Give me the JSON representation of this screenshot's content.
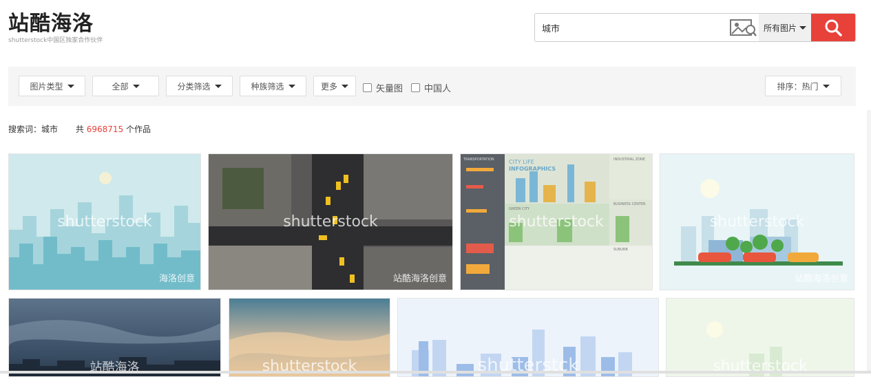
{
  "logo": {
    "title": "站酷海洛",
    "subtitle": "shutterstock中国区独家合作伙伴"
  },
  "search": {
    "query": "城市",
    "scope": "所有图片",
    "image_search_icon": "image-search-icon",
    "search_icon": "magnifier-icon"
  },
  "filters": {
    "buttons": [
      "图片类型",
      "全部",
      "分类筛选",
      "种族筛选",
      "更多"
    ],
    "checkboxes": [
      "矢量图",
      "中国人"
    ],
    "sort": "排序：热门"
  },
  "summary": {
    "keyword_label": "搜索词：城市",
    "prefix": "共",
    "count": "6968715",
    "suffix": "个作品"
  },
  "results": [
    {
      "watermark": "shutterstock",
      "corner_text": "海洛创意"
    },
    {
      "watermark": "shutterstock",
      "corner_text": "站酷海洛创意"
    },
    {
      "watermark": "shutterstock",
      "corner_text": "",
      "labels": [
        "CITY LIFE",
        "INFOGRAPHICS",
        "TRANSPORTATION",
        "INDUSTRIAL ZONE",
        "BUSINESS CENTER",
        "GREEN CITY",
        "SUBURB"
      ]
    },
    {
      "watermark": "shutterstock",
      "corner_text": "站酷海洛创意"
    },
    {
      "watermark": "站酷海洛",
      "corner_text": ""
    },
    {
      "watermark": "shutterstock",
      "corner_text": ""
    },
    {
      "watermark": "shutterstck",
      "corner_text": ""
    },
    {
      "watermark": "shutterstock",
      "corner_text": ""
    }
  ],
  "colors": {
    "accent": "#e8413a",
    "filter_bg": "#f5f5f5"
  }
}
